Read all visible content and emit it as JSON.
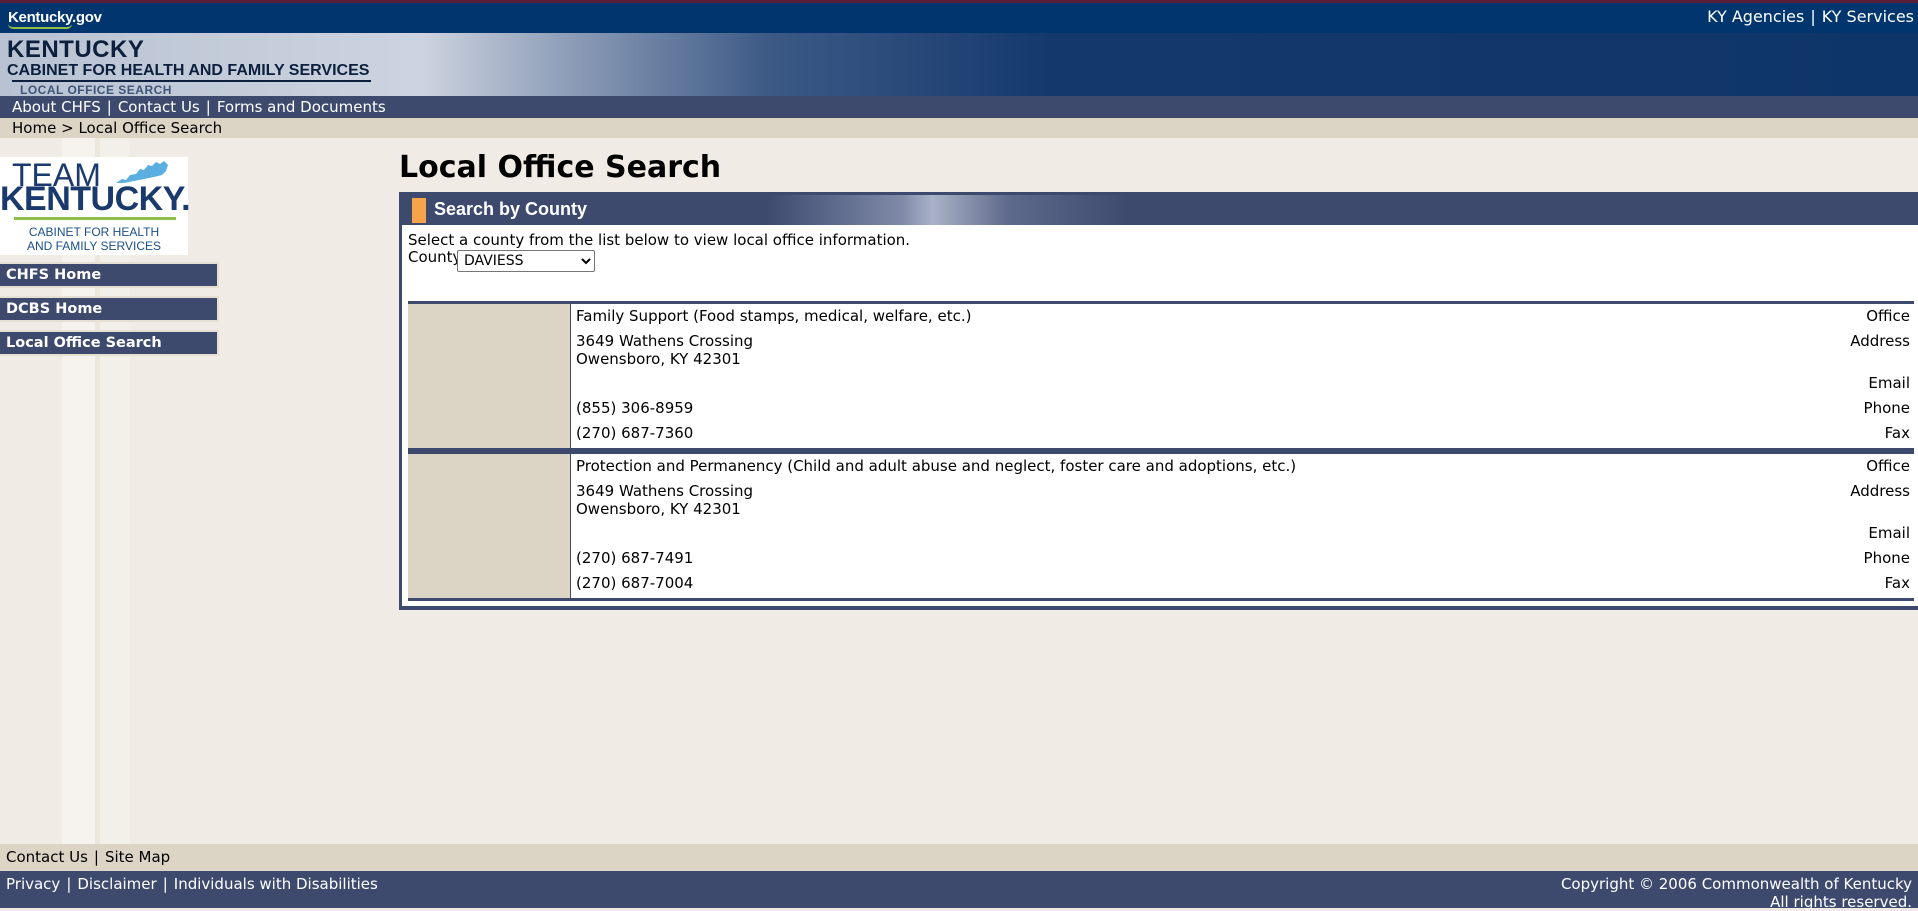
{
  "header": {
    "kygov_label": "Kentucky.gov",
    "banner_line1": "KENTUCKY",
    "banner_line2": "CABINET FOR HEALTH AND FAMILY SERVICES",
    "banner_line3": "LOCAL OFFICE SEARCH",
    "top_links": [
      "KY Agencies",
      "KY Services"
    ]
  },
  "nav": {
    "links": [
      "About CHFS",
      "Contact Us",
      "Forms and Documents"
    ]
  },
  "breadcrumb": {
    "home": "Home",
    "separator": ">",
    "current": "Local Office Search"
  },
  "logo": {
    "team": "TEAM",
    "kentucky": "KENTUCKY.",
    "sub1": "CABINET FOR HEALTH",
    "sub2": "AND FAMILY SERVICES"
  },
  "sidebar": {
    "items": [
      "CHFS Home",
      "DCBS Home",
      "Local Office Search"
    ]
  },
  "main": {
    "title": "Local Office Search",
    "panel_title": "Search by County",
    "intro": "Select a county from the list below to view local office information.",
    "county_label": "County",
    "county_selected": "DAVIESS"
  },
  "offices": [
    {
      "labels": {
        "office": "Office",
        "address": "Address",
        "email": "Email",
        "phone": "Phone",
        "fax": "Fax"
      },
      "office": "Family Support (Food stamps, medical, welfare, etc.)",
      "address1": "3649 Wathens Crossing",
      "address2": "Owensboro, KY  42301",
      "email": "",
      "phone": "(855) 306-8959",
      "fax": "(270) 687-7360"
    },
    {
      "labels": {
        "office": "Office",
        "address": "Address",
        "email": "Email",
        "phone": "Phone",
        "fax": "Fax"
      },
      "office": "Protection and Permanency (Child and adult abuse and neglect, foster care and adoptions, etc.)",
      "address1": "3649 Wathens Crossing",
      "address2": "Owensboro, KY  42301",
      "email": "",
      "phone": "(270) 687-7491",
      "fax": "(270) 687-7004"
    }
  ],
  "footer": {
    "links1": [
      "Contact Us",
      "Site Map"
    ],
    "links2": [
      "Privacy",
      "Disclaimer",
      "Individuals with Disabilities"
    ],
    "copyright1": "Copyright © 2006 Commonwealth of Kentucky",
    "copyright2": "All rights reserved."
  },
  "colors": {
    "header_blue": "#00356e",
    "nav_slate": "#3d4a6e",
    "tan": "#dcd4c5",
    "accent_orange": "#f7a34a",
    "kygov_green": "#8fc04a"
  }
}
